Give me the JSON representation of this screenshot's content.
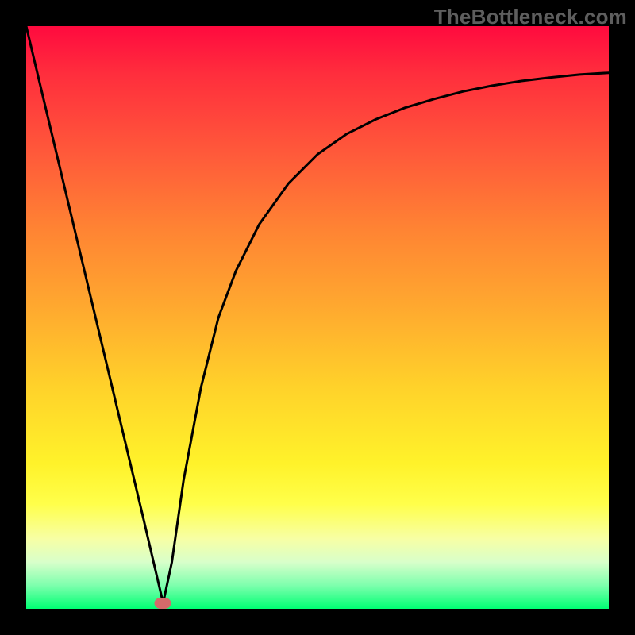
{
  "watermark": "TheBottleneck.com",
  "chart_data": {
    "type": "line",
    "title": "",
    "xlabel": "",
    "ylabel": "",
    "xlim": [
      0,
      100
    ],
    "ylim": [
      0,
      100
    ],
    "grid": false,
    "series": [
      {
        "name": "bottleneck-curve",
        "x": [
          0,
          5,
          10,
          15,
          20,
          23.5,
          25,
          27,
          30,
          33,
          36,
          40,
          45,
          50,
          55,
          60,
          65,
          70,
          75,
          80,
          85,
          90,
          95,
          100
        ],
        "values": [
          100,
          79,
          58,
          37,
          16,
          1,
          8,
          22,
          38,
          50,
          58,
          66,
          73,
          78,
          81.5,
          84,
          86,
          87.5,
          88.8,
          89.8,
          90.6,
          91.2,
          91.7,
          92
        ]
      }
    ],
    "annotations": [
      {
        "name": "min-marker",
        "x": 23.5,
        "y": 1
      }
    ],
    "background_gradient": {
      "top": "#ff0a3e",
      "bottom": "#00ff73"
    }
  }
}
